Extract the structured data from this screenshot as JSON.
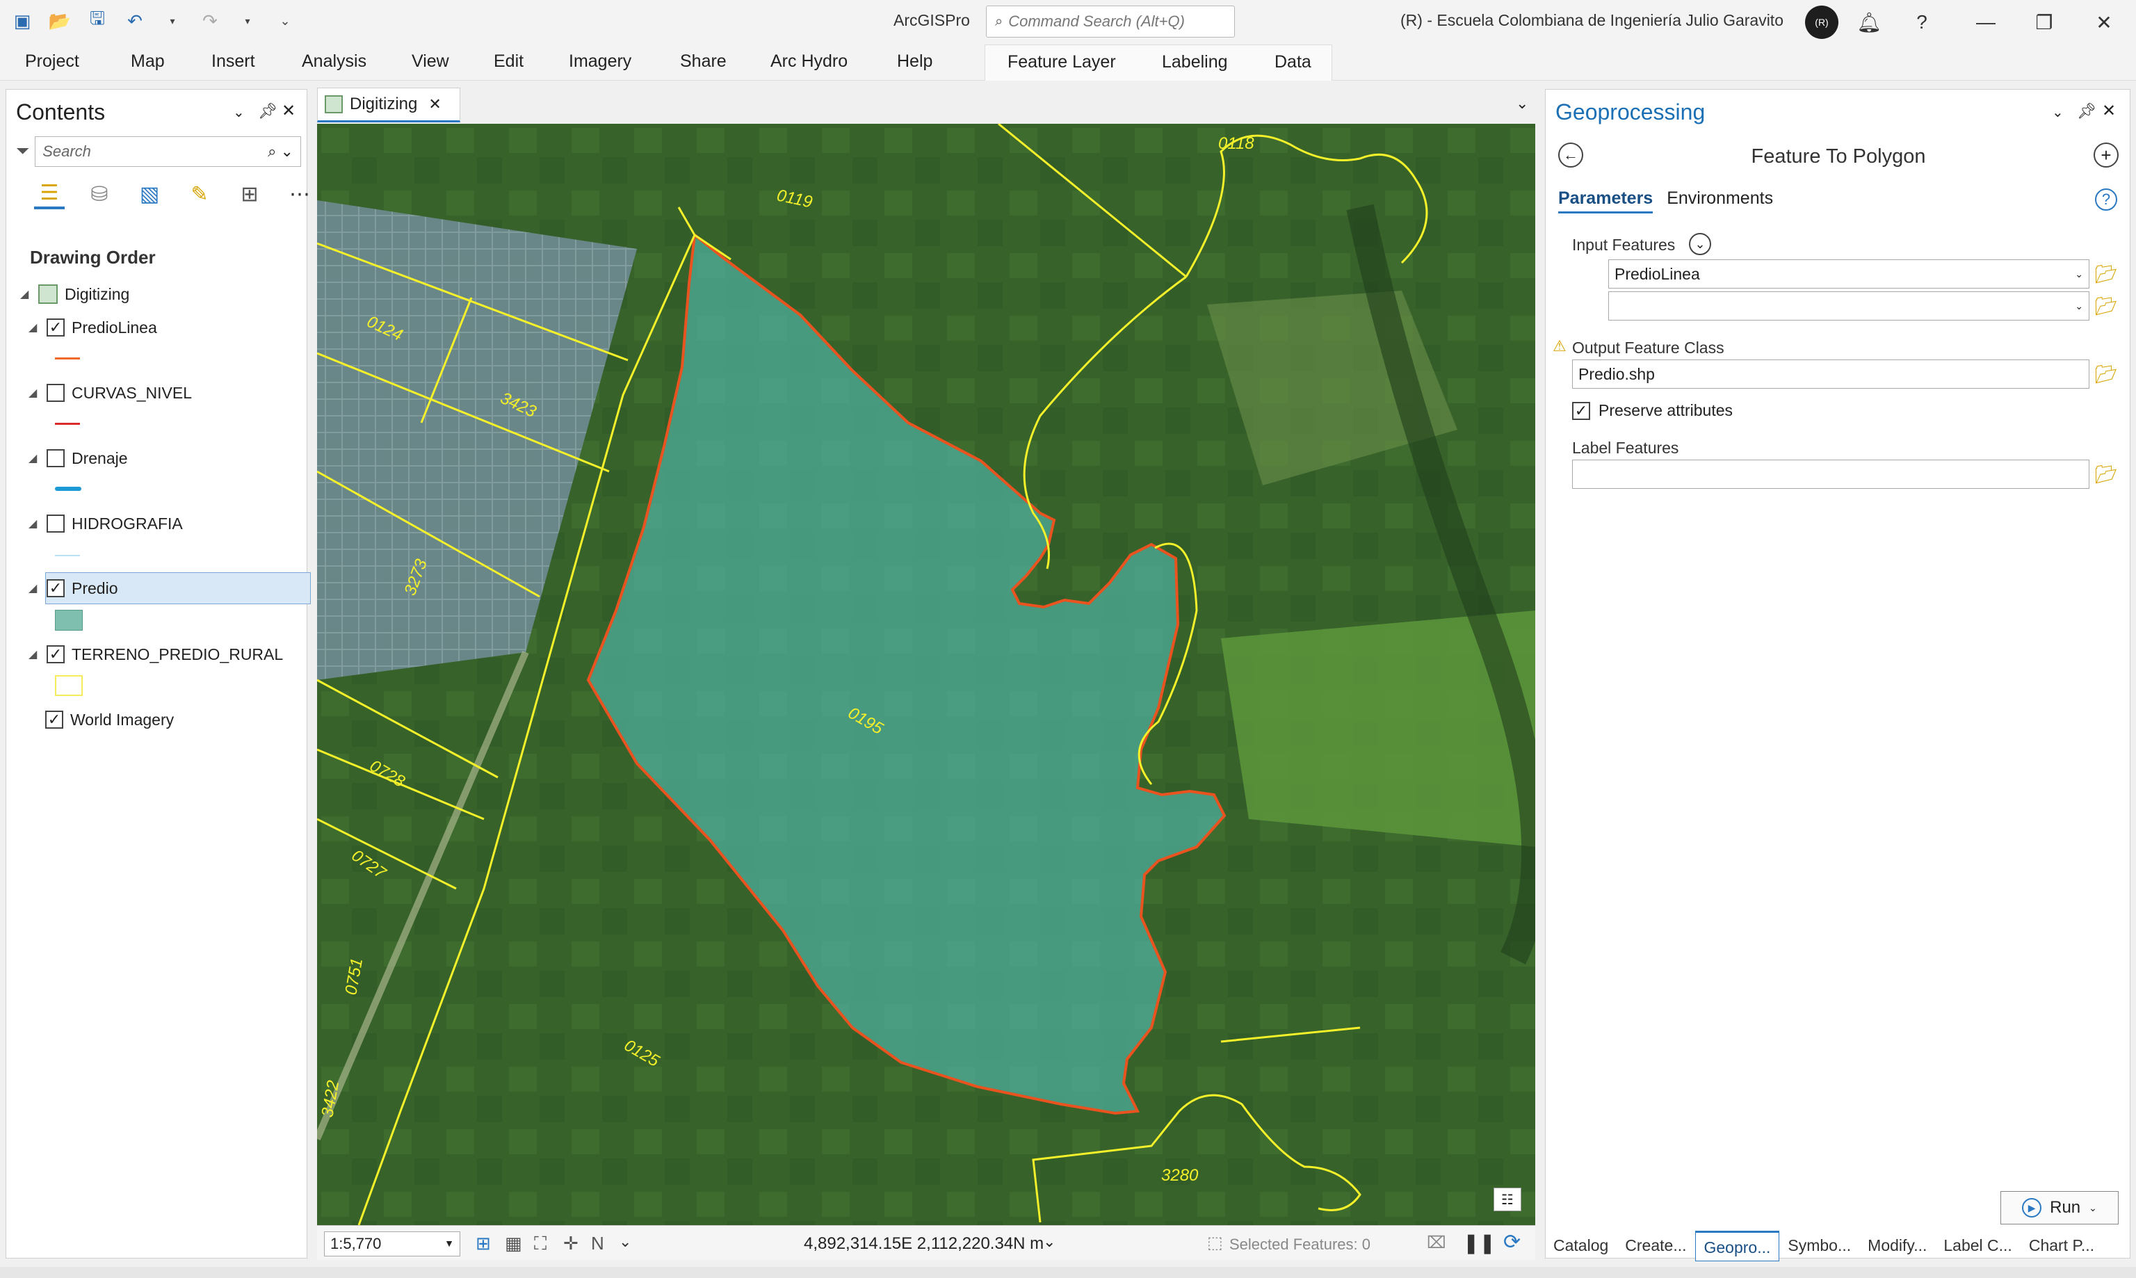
{
  "app": {
    "title": "ArcGISPro",
    "command_search_placeholder": "Command Search (Alt+Q)",
    "organization": "(R)  -  Escuela Colombiana de Ingeniería Julio Garavito",
    "avatar_initials": "(R)"
  },
  "menu": {
    "items": [
      "Project",
      "Map",
      "Insert",
      "Analysis",
      "View",
      "Edit",
      "Imagery",
      "Share",
      "Arc Hydro",
      "Help"
    ],
    "context_tabs": [
      "Feature Layer",
      "Labeling",
      "Data"
    ]
  },
  "contents": {
    "title": "Contents",
    "search_placeholder": "Search",
    "drawing_order_label": "Drawing Order",
    "map_name": "Digitizing",
    "layers": [
      {
        "name": "PredioLinea",
        "checked": true,
        "symbol": "line",
        "color": "#f06a2a"
      },
      {
        "name": "CURVAS_NIVEL",
        "checked": false,
        "symbol": "line",
        "color": "#d92b2b"
      },
      {
        "name": "Drenaje",
        "checked": false,
        "symbol": "line",
        "color": "#1b9ad6"
      },
      {
        "name": "HIDROGRAFIA",
        "checked": false,
        "symbol": "line",
        "color": "#b9e1f5"
      },
      {
        "name": "Predio",
        "checked": true,
        "symbol": "fill",
        "color": "#7fbfb0",
        "selected": true
      },
      {
        "name": "TERRENO_PREDIO_RURAL",
        "checked": true,
        "symbol": "fill-outline",
        "color": "#f4ec5a"
      },
      {
        "name": "World Imagery",
        "checked": true,
        "symbol": "none"
      }
    ]
  },
  "map": {
    "tab_label": "Digitizing",
    "parcel_labels": [
      "0118",
      "0119",
      "0124",
      "3423",
      "3273",
      "0195",
      "0728",
      "0727",
      "0751",
      "0125",
      "3422",
      "3280"
    ],
    "scale": "1:5,770",
    "coordinates": "4,892,314.15E 2,112,220.34N m",
    "selected_features": "Selected Features: 0",
    "colors": {
      "parcel_line": "#f4f02a",
      "predio_outline": "#e8531f",
      "predio_fill": "#4fb0a0"
    }
  },
  "geoprocessing": {
    "title": "Geoprocessing",
    "tool_name": "Feature To Polygon",
    "tabs": [
      "Parameters",
      "Environments"
    ],
    "input_features_label": "Input Features",
    "input_features_value": "PredioLinea",
    "output_label": "Output Feature Class",
    "output_value": "Predio.shp",
    "preserve_label": "Preserve attributes",
    "preserve_checked": true,
    "label_features_label": "Label Features",
    "run_label": "Run"
  },
  "bottom_tabs": [
    "Catalog",
    "Create...",
    "Geopro...",
    "Symbo...",
    "Modify...",
    "Label C...",
    "Chart P..."
  ]
}
